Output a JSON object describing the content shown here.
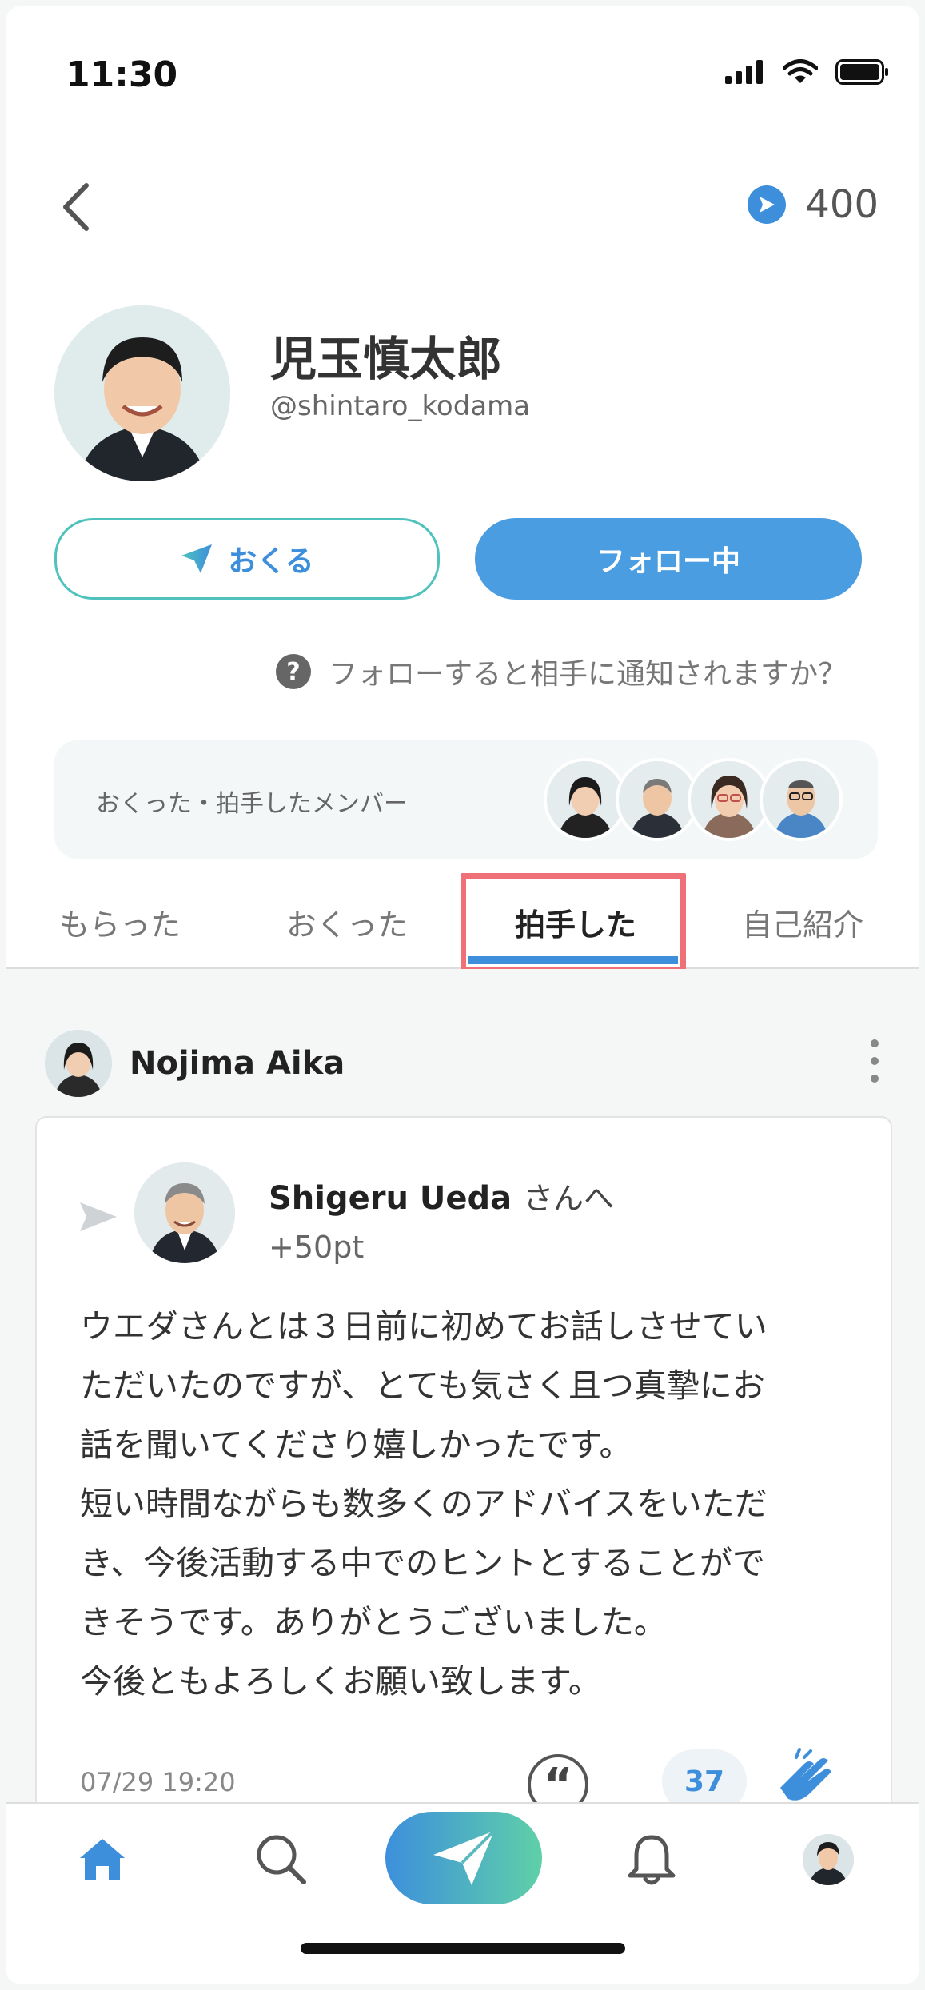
{
  "status_bar": {
    "time": "11:30"
  },
  "header": {
    "points": "400"
  },
  "profile": {
    "name": "児玉慎太郎",
    "handle": "@shintaro_kodama"
  },
  "actions": {
    "send_label": "おくる",
    "follow_label": "フォロー中"
  },
  "help": {
    "icon_text": "?",
    "text": "フォローすると相手に通知されますか？"
  },
  "members": {
    "label": "おくった・拍手したメンバー"
  },
  "tabs": [
    {
      "label": "もらった"
    },
    {
      "label": "おくった"
    },
    {
      "label": "拍手した"
    },
    {
      "label": "自己紹介"
    }
  ],
  "active_tab": "拍手した",
  "post": {
    "author": "Nojima Aika",
    "recipient": "Shigeru Ueda",
    "recipient_suffix": "さんへ",
    "points": "+50pt",
    "message_lines": [
      "ウエダさんとは３日前に初めてお話しさせてい",
      "ただいたのですが、とても気さく且つ真摯にお",
      "話を聞いてくださり嬉しかったです。",
      "短い時間ながらも数多くのアドバイスをいただ",
      "き、今後活動する中でのヒントとすることがで",
      "きそうです。ありがとうございました。",
      "今後ともよろしくお願い致します。"
    ],
    "date": "07/29 19:20",
    "quote_icon_text": "“",
    "clap_count": "37"
  },
  "colors": {
    "accent": "#3d8fdc",
    "tab_highlight": "#f07077",
    "teal": "#4fc2bd"
  }
}
